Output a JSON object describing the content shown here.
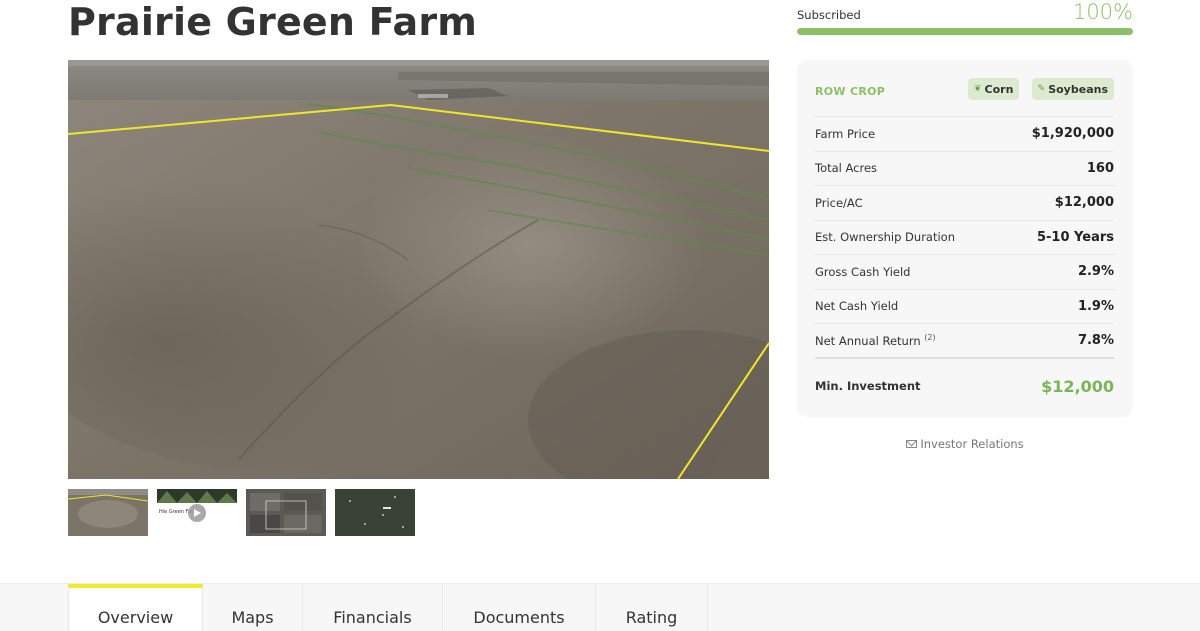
{
  "page": {
    "title": "Prairie Green Farm"
  },
  "subscription": {
    "label": "Subscribed",
    "percent_text": "100%",
    "progress_fraction": 1.0,
    "accent": "#8cc068"
  },
  "summary": {
    "crop_type": "ROW CROP",
    "tags": [
      {
        "label": "Corn",
        "icon": "corn-icon"
      },
      {
        "label": "Soybeans",
        "icon": "leaf-icon"
      }
    ],
    "rows": [
      {
        "key": "Farm Price",
        "value": "$1,920,000"
      },
      {
        "key": "Total Acres",
        "value": "160"
      },
      {
        "key": "Price/AC",
        "value": "$12,000"
      },
      {
        "key": "Est. Ownership Duration",
        "value": "5-10 Years"
      },
      {
        "key": "Gross Cash Yield",
        "value": "2.9%"
      },
      {
        "key": "Net Cash Yield",
        "value": "1.9%"
      },
      {
        "key": "Net Annual Return",
        "note": "(2)",
        "value": "7.8%"
      }
    ],
    "min_investment": {
      "key": "Min. Investment",
      "value": "$12,000"
    }
  },
  "investor_relations": {
    "label": "Investor Relations",
    "icon": "envelope-icon"
  },
  "gallery": {
    "thumbnails": [
      {
        "name": "aerial-field-thumbnail"
      },
      {
        "name": "video-thumbnail",
        "caption": "Hie Green Farm",
        "icon": "play-icon"
      },
      {
        "name": "parcel-map-thumbnail"
      },
      {
        "name": "satellite-map-thumbnail"
      }
    ]
  },
  "tabs": [
    {
      "label": "Overview",
      "active": true
    },
    {
      "label": "Maps"
    },
    {
      "label": "Financials"
    },
    {
      "label": "Documents"
    },
    {
      "label": "Rating"
    }
  ],
  "colors": {
    "tab_active_bar": "#f2e82c",
    "boundary_line": "#f0e62a"
  }
}
